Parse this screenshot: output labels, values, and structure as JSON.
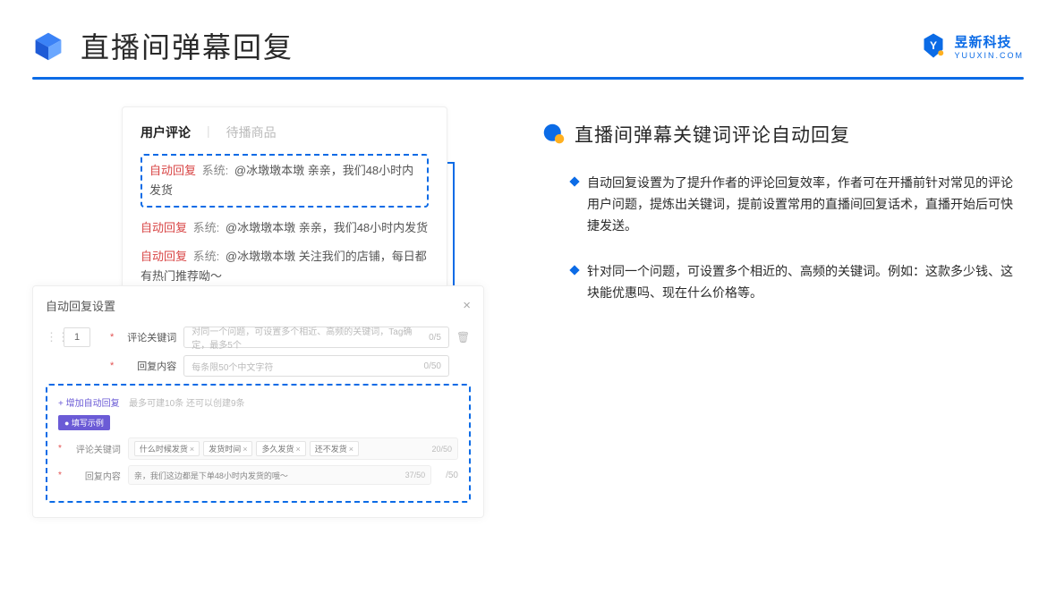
{
  "header": {
    "title": "直播间弹幕回复",
    "logo_text": "昱新科技",
    "logo_sub": "YUUXIN.COM"
  },
  "comments": {
    "tab_active": "用户评论",
    "tab_inactive": "待播商品",
    "auto_label": "自动回复",
    "sys_label": "系统:",
    "row1": "@冰墩墩本墩 亲亲，我们48小时内发货",
    "row2": "@冰墩墩本墩 亲亲，我们48小时内发货",
    "row3": "@冰墩墩本墩 关注我们的店铺，每日都有热门推荐呦～"
  },
  "settings": {
    "title": "自动回复设置",
    "num": "1",
    "kw_label": "评论关键词",
    "kw_placeholder": "对同一个问题，可设置多个相近、高频的关键词，Tag确定，最多5个",
    "kw_count": "0/5",
    "reply_label": "回复内容",
    "reply_placeholder": "每条限50个中文字符",
    "reply_count": "0/50",
    "add_link": "+ 增加自动回复",
    "add_hint": "最多可建10条 还可以创建9条",
    "badge": "● 填写示例",
    "ex_kw_label": "评论关键词",
    "tags": [
      "什么时候发货",
      "发货时间",
      "多久发货",
      "还不发货"
    ],
    "ex_kw_count": "20/50",
    "ex_reply_label": "回复内容",
    "ex_reply_text": "亲，我们这边都是下单48小时内发货的哦～",
    "ex_reply_count": "37/50",
    "outer_count": "/50"
  },
  "right": {
    "title": "直播间弹幕关键词评论自动回复",
    "b1": "自动回复设置为了提升作者的评论回复效率，作者可在开播前针对常见的评论用户问题，提炼出关键词，提前设置常用的直播间回复话术，直播开始后可快捷发送。",
    "b2": "针对同一个问题，可设置多个相近的、高频的关键词。例如：这款多少钱、这块能优惠吗、现在什么价格等。"
  }
}
